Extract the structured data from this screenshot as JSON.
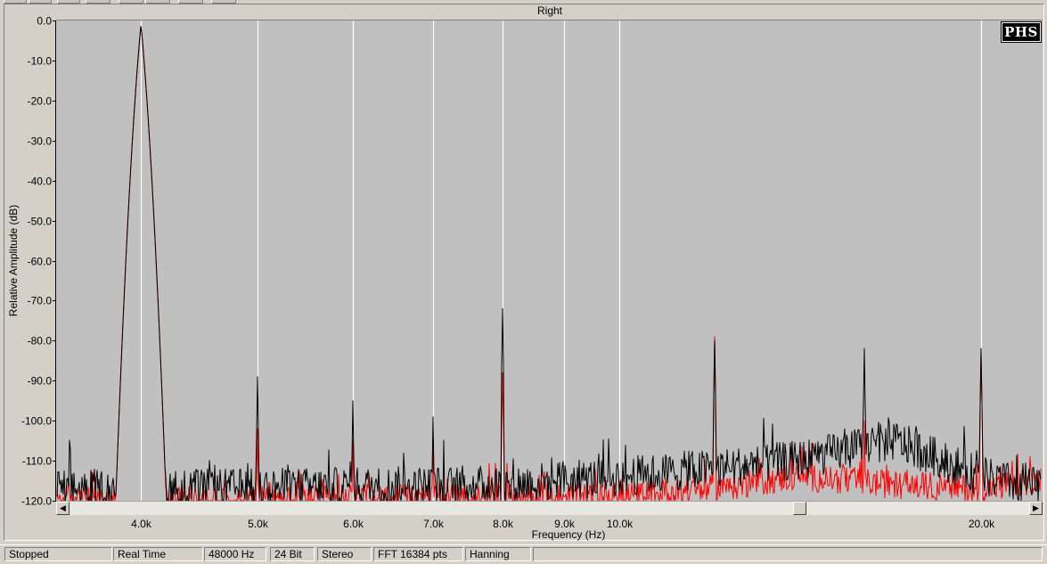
{
  "chart_data": {
    "type": "line",
    "title": "Right",
    "xlabel": "Frequency (Hz)",
    "ylabel": "Relative Amplitude (dB)",
    "x_scale": "log",
    "xlim": [
      3400,
      22500
    ],
    "ylim": [
      -120,
      0
    ],
    "x_ticks": [
      {
        "value": 4000,
        "label": "4.0k"
      },
      {
        "value": 5000,
        "label": "5.0k"
      },
      {
        "value": 6000,
        "label": "6.0k"
      },
      {
        "value": 7000,
        "label": "7.0k"
      },
      {
        "value": 8000,
        "label": "8.0k"
      },
      {
        "value": 9000,
        "label": "9.0k"
      },
      {
        "value": 10000,
        "label": "10.0k"
      },
      {
        "value": 20000,
        "label": "20.0k"
      }
    ],
    "y_ticks": [
      {
        "value": 0,
        "label": "0.0"
      },
      {
        "value": -10,
        "label": "-10.0"
      },
      {
        "value": -20,
        "label": "-20.0"
      },
      {
        "value": -30,
        "label": "-30.0"
      },
      {
        "value": -40,
        "label": "-40.0"
      },
      {
        "value": -50,
        "label": "-50.0"
      },
      {
        "value": -60,
        "label": "-60.0"
      },
      {
        "value": -70,
        "label": "-70.0"
      },
      {
        "value": -80,
        "label": "-80.0"
      },
      {
        "value": -90,
        "label": "-90.0"
      },
      {
        "value": -100,
        "label": "-100.0"
      },
      {
        "value": -110,
        "label": "-110.0"
      },
      {
        "value": -120,
        "label": "-120.0"
      }
    ],
    "grid": true,
    "background_color": "#c0c0c0",
    "grid_color": "#ffffff",
    "series": [
      {
        "color": "#000000",
        "peaks": [
          {
            "x": 4000,
            "y": -1
          },
          {
            "x": 5000,
            "y": -89
          },
          {
            "x": 6000,
            "y": -95
          },
          {
            "x": 7000,
            "y": -99
          },
          {
            "x": 8000,
            "y": -72
          },
          {
            "x": 12000,
            "y": -80
          },
          {
            "x": 16000,
            "y": -82
          },
          {
            "x": 20000,
            "y": -82
          }
        ],
        "floor": [
          {
            "x": 3400,
            "y": -117
          },
          {
            "x": 4600,
            "y": -117
          },
          {
            "x": 8000,
            "y": -116
          },
          {
            "x": 10000,
            "y": -114
          },
          {
            "x": 12000,
            "y": -112
          },
          {
            "x": 14000,
            "y": -110
          },
          {
            "x": 17000,
            "y": -105
          },
          {
            "x": 20000,
            "y": -114
          },
          {
            "x": 22500,
            "y": -117
          }
        ]
      },
      {
        "color": "#ff0000",
        "peaks": [
          {
            "x": 4000,
            "y": -1
          },
          {
            "x": 5000,
            "y": -102
          },
          {
            "x": 6000,
            "y": -105
          },
          {
            "x": 7000,
            "y": -105
          },
          {
            "x": 8000,
            "y": -88
          },
          {
            "x": 12000,
            "y": -79
          },
          {
            "x": 16000,
            "y": -100
          },
          {
            "x": 20000,
            "y": -82
          }
        ],
        "floor": [
          {
            "x": 3400,
            "y": -120
          },
          {
            "x": 4600,
            "y": -120
          },
          {
            "x": 8000,
            "y": -119
          },
          {
            "x": 10000,
            "y": -119
          },
          {
            "x": 12000,
            "y": -117
          },
          {
            "x": 14000,
            "y": -114
          },
          {
            "x": 17000,
            "y": -116
          },
          {
            "x": 20000,
            "y": -117
          },
          {
            "x": 22500,
            "y": -115
          }
        ]
      }
    ]
  },
  "logo_text": "PHS",
  "status": [
    "Stopped",
    "Real Time",
    "48000 Hz",
    "24 Bit",
    "Stereo",
    "FFT 16384 pts",
    "Hanning",
    ""
  ],
  "scroll_left_glyph": "◀",
  "scroll_right_glyph": "▶"
}
